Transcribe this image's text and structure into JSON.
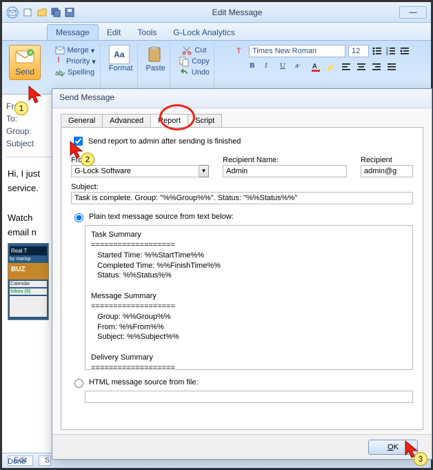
{
  "titlebar": {
    "title": "Edit Message"
  },
  "ribbon_tabs": {
    "message": "Message",
    "edit": "Edit",
    "tools": "Tools",
    "glock": "G-Lock Analytics"
  },
  "ribbon": {
    "send": "Send",
    "merge": "Merge",
    "priority": "Priority",
    "spelling": "Spelling",
    "format": "Format",
    "paste": "Paste",
    "cut": "Cut",
    "copy": "Copy",
    "undo": "Undo",
    "font": "Times New Roman",
    "size": "12"
  },
  "fields": {
    "from": "From:",
    "to": "To:",
    "group": "Group:",
    "subject": "Subject"
  },
  "msg": {
    "p1": "Hi, I just",
    "p2": "service.",
    "p3": "Watch",
    "p4": "email n"
  },
  "thumb": {
    "t1": "Real T",
    "t2": "by marisp",
    "t3": "Calendar",
    "t4": "Inbox (5)"
  },
  "status": {
    "edit": "Edit",
    "s": "S",
    "done": "Done"
  },
  "dialog": {
    "title": "Send Message",
    "tabs": {
      "general": "General",
      "advanced": "Advanced",
      "report": "Report",
      "script": "Script"
    },
    "checkbox_label": "Send report to admin after sending is finished",
    "from_label": "From:",
    "from_value": "G-Lock Software",
    "recip_name_label": "Recipient Name:",
    "recip_name_value": "Admin",
    "recip_label": "Recipient",
    "recip_value": "admin@g",
    "subject_label": "Subject:",
    "subject_value": "Task is complete. Group: \"%%Group%%\". Status: \"%%Status%%\"",
    "radio_plain": "Plain text message source from text below:",
    "radio_html": "HTML message source from file:",
    "report_text": "Task Summary\n===================\n   Started Time: %%StartTime%%\n   Completed Time: %%FinishTime%%\n   Status: %%Status%%\n\nMessage Summary\n===================\n   Group: %%Group%%\n   From: %%From%%\n   Subject: %%Subject%%\n\nDelivery Summary\n===================\n   Total: %%Total%%\n   Processed: %%Processed%%\n   Excluded : %%Excluded%%",
    "ok": "OK"
  }
}
